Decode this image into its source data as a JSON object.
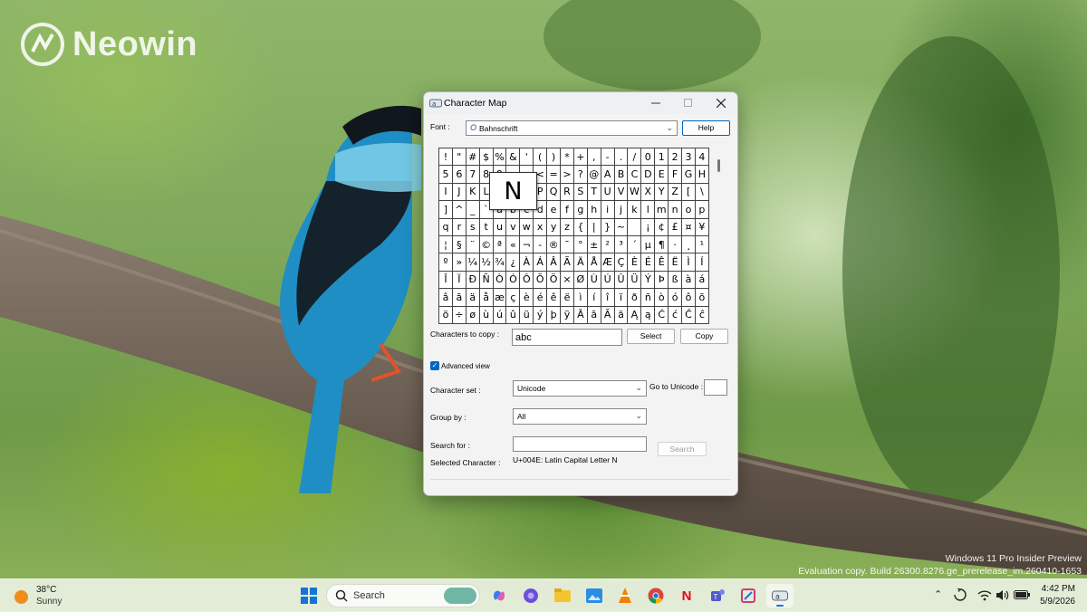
{
  "desktop": {
    "watermark": "Neowin",
    "eval_line1": "Windows 11 Pro Insider Preview",
    "eval_line2": "Evaluation copy. Build 26300.8276.ge_prerelease_im.260410-1653"
  },
  "window": {
    "title": "Character Map",
    "font_label": "Font :",
    "font_value": "Bahnschrift",
    "help_label": "Help",
    "chars": [
      "!",
      "\"",
      "#",
      "$",
      "%",
      "&",
      "'",
      "(",
      ")",
      "*",
      "+",
      ",",
      "-",
      ".",
      "/",
      "0",
      "1",
      "2",
      "3",
      "4",
      "5",
      "6",
      "7",
      "8",
      "9",
      ":",
      ";",
      "<",
      "=",
      ">",
      "?",
      "@",
      "A",
      "B",
      "C",
      "D",
      "E",
      "F",
      "G",
      "H",
      "I",
      "J",
      "K",
      "L",
      "M",
      "N",
      "O",
      "P",
      "Q",
      "R",
      "S",
      "T",
      "U",
      "V",
      "W",
      "X",
      "Y",
      "Z",
      "[",
      "\\",
      "]",
      "^",
      "_",
      "`",
      "a",
      "b",
      "c",
      "d",
      "e",
      "f",
      "g",
      "h",
      "i",
      "j",
      "k",
      "l",
      "m",
      "n",
      "o",
      "p",
      "q",
      "r",
      "s",
      "t",
      "u",
      "v",
      "w",
      "x",
      "y",
      "z",
      "{",
      "|",
      "}",
      "~",
      " ",
      "¡",
      "¢",
      "£",
      "¤",
      "¥",
      "¦",
      "§",
      "¨",
      "©",
      "ª",
      "«",
      "¬",
      "-",
      "®",
      "¯",
      "°",
      "±",
      "²",
      "³",
      "´",
      "µ",
      "¶",
      "·",
      "¸",
      "¹",
      "º",
      "»",
      "¼",
      "½",
      "¾",
      "¿",
      "À",
      "Á",
      "Â",
      "Ã",
      "Ä",
      "Å",
      "Æ",
      "Ç",
      "È",
      "É",
      "Ê",
      "Ë",
      "Ì",
      "Í",
      "Î",
      "Ï",
      "Ð",
      "Ñ",
      "Ò",
      "Ó",
      "Ô",
      "Õ",
      "Ö",
      "×",
      "Ø",
      "Ù",
      "Ú",
      "Û",
      "Ü",
      "Ý",
      "Þ",
      "ß",
      "à",
      "á",
      "â",
      "ã",
      "ä",
      "å",
      "æ",
      "ç",
      "è",
      "é",
      "ê",
      "ë",
      "ì",
      "í",
      "î",
      "ï",
      "ð",
      "ñ",
      "ò",
      "ó",
      "ô",
      "õ",
      "ö",
      "÷",
      "ø",
      "ù",
      "ú",
      "û",
      "ü",
      "ý",
      "þ",
      "ÿ",
      "Ā",
      "ā",
      "Ă",
      "ă",
      "Ą",
      "ą",
      "Ć",
      "ć",
      "Ĉ",
      "ĉ"
    ],
    "magnified_char": "N",
    "chars_to_copy_label": "Characters to copy :",
    "chars_to_copy_value": "abc",
    "select_label": "Select",
    "copy_label": "Copy",
    "advanced_view_label": "Advanced view",
    "advanced_view_checked": true,
    "char_set_label": "Character set :",
    "char_set_value": "Unicode",
    "go_to_unicode_label": "Go to Unicode :",
    "group_by_label": "Group by :",
    "group_by_value": "All",
    "search_for_label": "Search for :",
    "search_button_label": "Search",
    "selected_char_label": "Selected Character :",
    "selected_char_value": "U+004E: Latin Capital Letter N"
  },
  "taskbar": {
    "temperature": "38°C",
    "condition": "Sunny",
    "search_placeholder": "Search",
    "time": "4:42 PM",
    "date": "5/9/2026",
    "colors": {
      "weather_sun": "#f08c1c",
      "netflix": "#e50914",
      "edge_blue": "#1a73e8"
    }
  }
}
